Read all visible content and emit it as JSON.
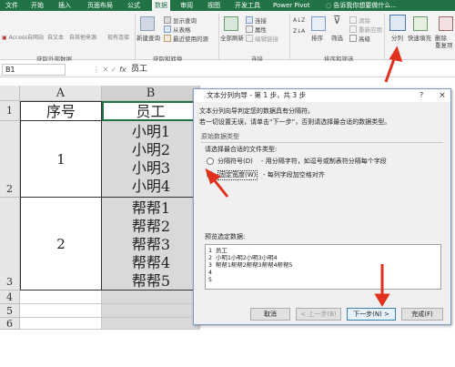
{
  "ribbon_tabs": [
    "文件",
    "开始",
    "插入",
    "页面布局",
    "公式",
    "数据",
    "审阅",
    "视图",
    "开发工具",
    "Power Pivot"
  ],
  "active_tab": "数据",
  "search_placeholder": "告诉我你想要做什么...",
  "ribbon": {
    "get_external": [
      "Access",
      "自网站",
      "自文本",
      "自其他来源",
      "现有连接"
    ],
    "get_external_group": "获取外部数据",
    "new_query": "新建查询",
    "query_items": [
      "显示查询",
      "从表格",
      "最近使用的源"
    ],
    "get_transform_group": "获取和转换",
    "refresh_all": "全部刷新",
    "conn_items": [
      "连接",
      "属性",
      "编辑链接"
    ],
    "conn_group": "连接",
    "sort_asc": "A↓Z",
    "sort_desc": "Z↓A",
    "sort": "排序",
    "filter": "筛选",
    "filter_items": [
      "清除",
      "重新应用",
      "高级"
    ],
    "sort_filter_group": "排序和筛选",
    "split_column": "分列",
    "flash_fill": "快速填充",
    "remove_dup": "删除\n重复项"
  },
  "formula_bar": {
    "name_box": "B1",
    "fx": "fx",
    "content": "员工"
  },
  "columns": [
    "A",
    "B"
  ],
  "rows": [
    "1",
    "2",
    "3",
    "4",
    "5",
    "6"
  ],
  "cells": {
    "a1": "序号",
    "b1": "员工",
    "a2": "1",
    "a3": "2",
    "group1": [
      "小明1",
      "小明2",
      "小明3",
      "小明4"
    ],
    "group2": [
      "帮帮1",
      "帮帮2",
      "帮帮3",
      "帮帮4",
      "帮帮5"
    ]
  },
  "dialog": {
    "title": "文本分列向导 - 第 1 步，共 3 步",
    "help": "?",
    "close": "×",
    "intro1": "文本分列向导判定您的数据具有分隔符。",
    "intro2": "若一切设置无误，请单击“下一步”，否则请选择最合适的数据类型。",
    "section_title": "原始数据类型",
    "choose_label": "请选择最合适的文件类型:",
    "opt1": "分隔符号(D)",
    "opt1_desc": "- 用分隔字符，如逗号或制表符分隔每个字段",
    "opt2": "固定宽度(W)",
    "opt2_desc": "- 每列字段加空格对齐",
    "preview_label": "预览选定数据:",
    "preview_lines": [
      "1 员工",
      "2 小明1小明2小明3小明4",
      "3 帮帮1帮帮2帮帮3帮帮4帮帮5",
      "4",
      "5"
    ],
    "btn_cancel": "取消",
    "btn_back": "< 上一步(B)",
    "btn_next": "下一步(N) >",
    "btn_finish": "完成(F)"
  },
  "colors": {
    "ribbon_green": "#217346",
    "arrow_red": "#e0301e"
  }
}
